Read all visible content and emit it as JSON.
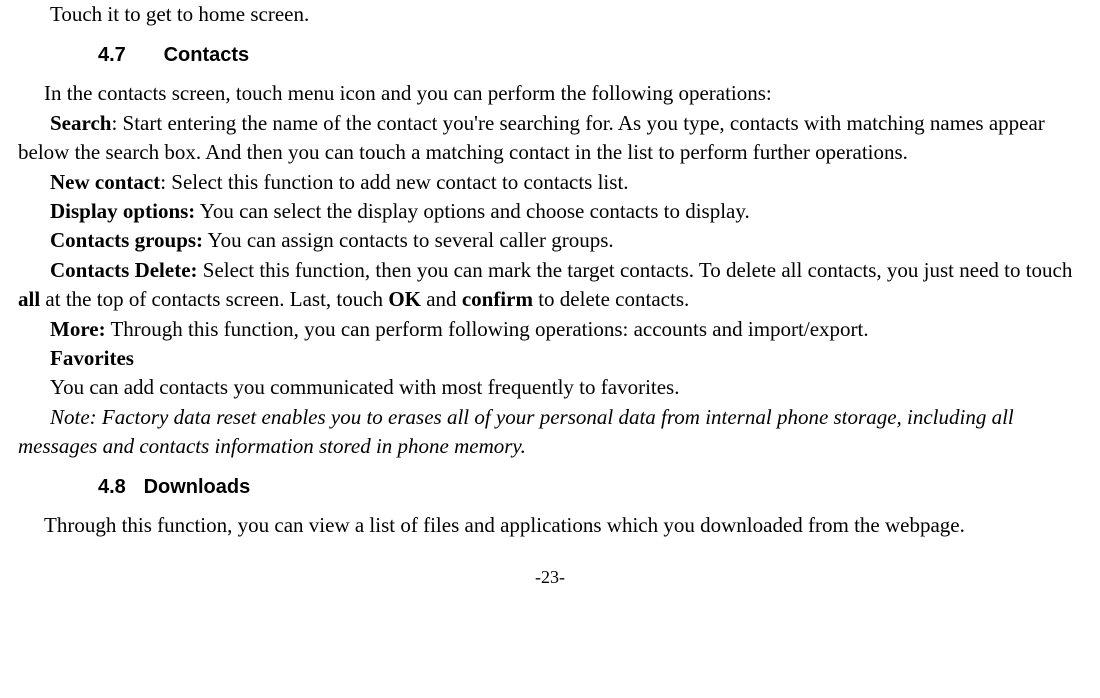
{
  "top_line": "Touch it to get to home screen.",
  "section47": {
    "num": "4.7",
    "title": "Contacts",
    "intro": "In the contacts screen, touch menu icon and you can perform the following operations:",
    "search_label": "Search",
    "search_text": ": Start entering the name of the contact you're searching for. As you type, contacts with matching names appear below the search box. And then you can touch a matching contact in the list to perform further operations.",
    "newcontact_label": "New contact",
    "newcontact_text": ": Select this function to add new contact to contacts list.",
    "display_label": "Display options:",
    "display_text": " You can select the display options and choose contacts to display.",
    "groups_label": "Contacts groups:",
    "groups_text": " You can assign contacts to several caller groups.",
    "delete_label": "Contacts Delete:",
    "delete_text1": " Select this function, then you can mark the target contacts. To delete all contacts, you just need to touch ",
    "delete_all": "all",
    "delete_text2": " at the top of contacts screen. Last, touch ",
    "delete_ok": "OK",
    "delete_text3": " and ",
    "delete_confirm": "confirm",
    "delete_text4": " to delete contacts.",
    "more_label": "More:",
    "more_text": " Through this function, you can perform following operations: accounts and import/export.",
    "fav_label": "Favorites",
    "fav_text": "You can add contacts you communicated with most frequently to favorites.",
    "note": "Note: Factory data reset enables you to erases all of your personal data from internal phone storage, including all messages and contacts information stored in phone memory."
  },
  "section48": {
    "num": "4.8",
    "title": "Downloads",
    "body": "Through this function, you can view a list of files and applications which you downloaded from the webpage."
  },
  "page_number": "-23-"
}
